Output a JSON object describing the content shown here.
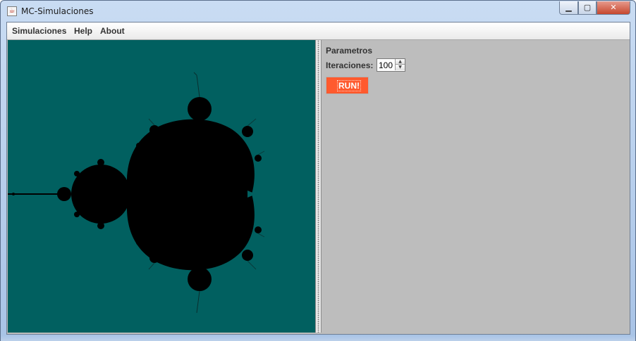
{
  "window": {
    "title": "MC-Simulaciones",
    "controls": {
      "minimize": "▁",
      "maximize": "▢",
      "close": "✕"
    }
  },
  "menu": [
    "Simulaciones",
    "Help",
    "About"
  ],
  "fractal": {
    "background_color": "#016060",
    "set_color": "#000000"
  },
  "params": {
    "title": "Parametros",
    "iterations_label": "Iteraciones:",
    "iterations_value": "100",
    "run_label": "RUN!",
    "run_color": "#ff5a2e"
  },
  "icons": {
    "app": "java-cup-icon",
    "spin_up": "arrow-up-icon",
    "spin_down": "arrow-down-icon"
  }
}
